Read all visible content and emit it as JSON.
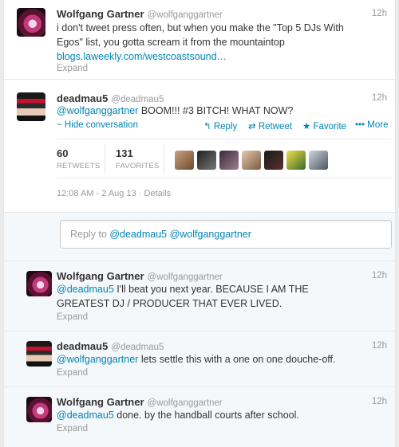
{
  "tweets": [
    {
      "name": "Wolfgang Gartner",
      "handle": "@wolfganggartner",
      "time": "12h",
      "text_line1": "i don't tweet press often, but when you make the \"Top 5 DJs With",
      "text_line2": "Egos\" list, you gotta scream it from the mountaintop",
      "link": "blogs.laweekly.com/westcoastsound…",
      "expand": "Expand",
      "avatar": "wolf-avatar"
    },
    {
      "name": "deadmau5",
      "handle": "@deadmau5",
      "time": "12h",
      "mention": "@wolfganggartner",
      "text": " BOOM!!! #3 BITCH!   WHAT NOW?",
      "hide_label": "Hide conversation",
      "reply_label": "Reply",
      "retweet_label": "Retweet",
      "favorite_label": "Favorite",
      "more_label": "More",
      "retweets_count": "60",
      "retweets_label": "RETWEETS",
      "favorites_count": "131",
      "favorites_label": "FAVORITES",
      "meta": "12:08 AM - 2 Aug 13 · Details",
      "avatar": "deadmau5-avatar"
    }
  ],
  "reply_box": {
    "prefix": "Reply to ",
    "mention1": "@deadmau5",
    "mention2": "@wolfganggartner"
  },
  "replies": [
    {
      "name": "Wolfgang Gartner",
      "handle": "@wolfganggartner",
      "time": "12h",
      "mention": "@deadmau5",
      "text_line1": " I'll beat you next year.  BECAUSE I AM THE",
      "text_line2": "GREATEST DJ / PRODUCER THAT EVER LIVED.",
      "expand": "Expand"
    },
    {
      "name": "deadmau5",
      "handle": "@deadmau5",
      "time": "12h",
      "mention": "@wolfganggartner",
      "text": " lets settle this with a one on one douche-off.",
      "expand": "Expand"
    },
    {
      "name": "Wolfgang Gartner",
      "handle": "@wolfganggartner",
      "time": "12h",
      "mention": "@deadmau5",
      "text": " done. by the handball courts after school.",
      "expand": "Expand"
    }
  ],
  "colors": {
    "link": "#0084b4",
    "muted": "#999999",
    "text": "#333333"
  },
  "icons": [
    "hide-conversation-icon",
    "reply-icon",
    "retweet-icon",
    "favorite-icon",
    "more-icon"
  ]
}
